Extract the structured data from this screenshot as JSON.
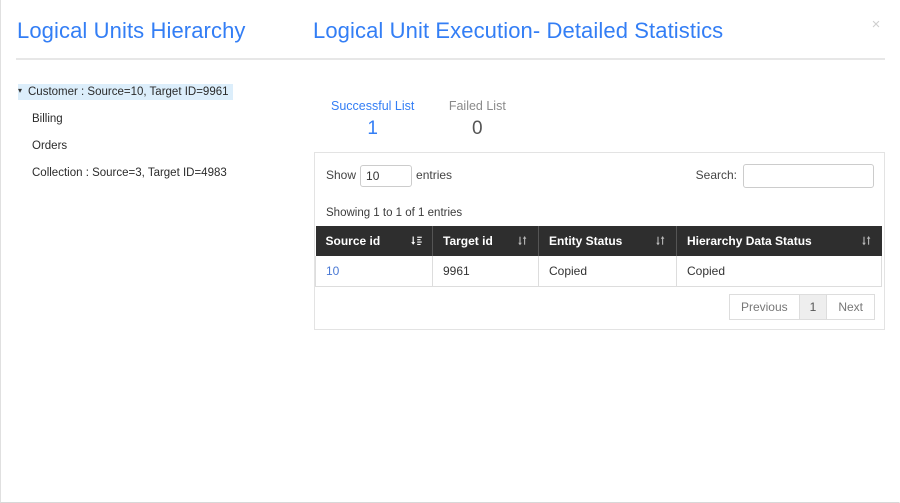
{
  "header": {
    "title_left": "Logical Units Hierarchy",
    "title_right": "Logical Unit Execution- Detailed Statistics",
    "close_label": "×"
  },
  "tree": {
    "root": {
      "label": "Customer : Source=10, Target ID=9961",
      "caret": "▾",
      "expanded": true,
      "highlight_color": "#dceefb"
    },
    "children": [
      {
        "label": "Billing"
      },
      {
        "label": "Orders"
      },
      {
        "label": "Collection : Source=3, Target ID=4983"
      }
    ]
  },
  "stats": {
    "tabs": [
      {
        "label": "Successful List",
        "value": "1",
        "state": "active",
        "color": "#337ef5"
      },
      {
        "label": "Failed List",
        "value": "0",
        "state": "inactive",
        "color": "#8a8a8a"
      }
    ]
  },
  "datatable": {
    "length": {
      "prefix": "Show",
      "value": "10",
      "suffix": "entries"
    },
    "search": {
      "label": "Search:",
      "value": "",
      "placeholder": ""
    },
    "info": "Showing 1 to 1 of 1 entries",
    "columns": [
      {
        "label": "Source id",
        "sort": "asc",
        "sort_icon": "sort-asc-icon"
      },
      {
        "label": "Target id",
        "sort": "none",
        "sort_icon": "sort-both-icon"
      },
      {
        "label": "Entity Status",
        "sort": "none",
        "sort_icon": "sort-both-icon"
      },
      {
        "label": "Hierarchy Data Status",
        "sort": "none",
        "sort_icon": "sort-both-icon"
      }
    ],
    "rows": [
      {
        "source_id": "10",
        "target_id": "9961",
        "entity_status": "Copied",
        "hierarchy_data_status": "Copied"
      }
    ],
    "pagination": {
      "previous": "Previous",
      "pages": [
        "1"
      ],
      "next": "Next",
      "current": "1"
    }
  },
  "colors": {
    "accent_blue": "#337ef5",
    "link_blue": "#4a79d4",
    "header_dark": "#2e2e2e",
    "tree_highlight": "#dceefb"
  }
}
